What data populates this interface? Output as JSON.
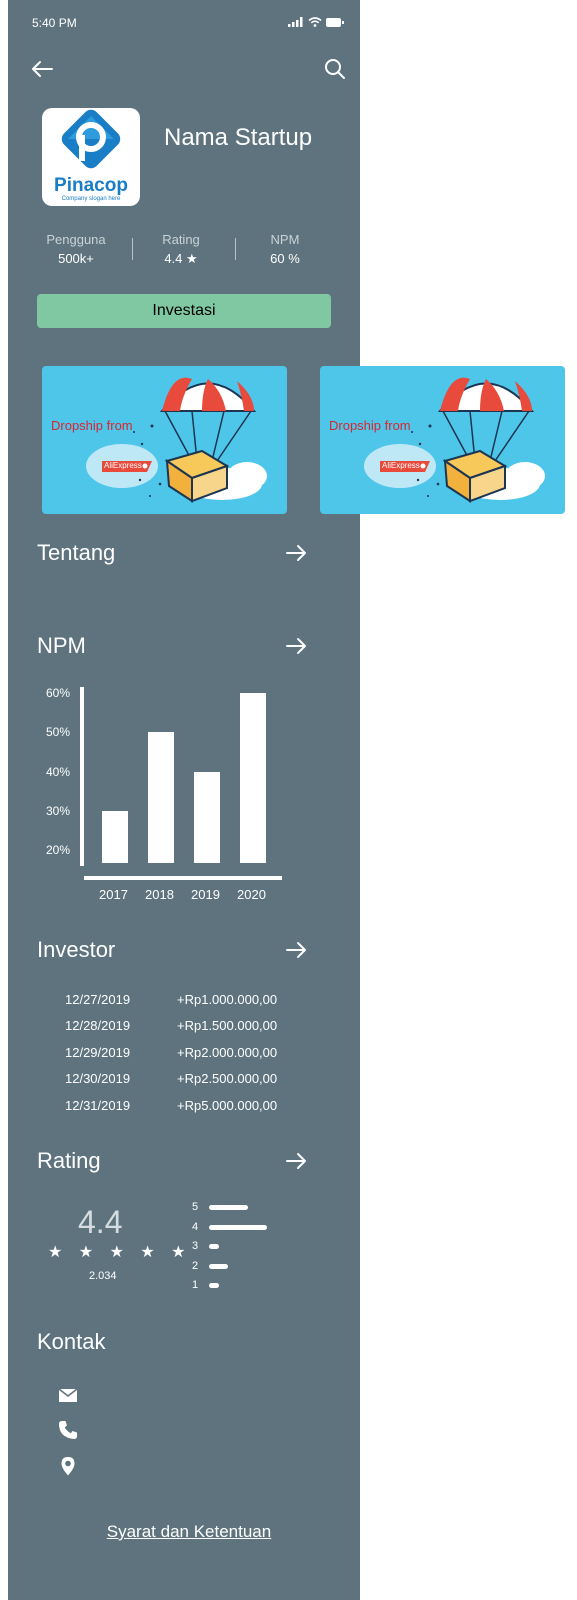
{
  "status": {
    "time": "5:40 PM"
  },
  "app": {
    "title": "Nama Startup",
    "logo_text": "Pinacop",
    "logo_slogan": "Company slogan here"
  },
  "stats": [
    {
      "label": "Pengguna",
      "value": "500k+"
    },
    {
      "label": "Rating",
      "value": "4.4 ★"
    },
    {
      "label": "NPM",
      "value": "60 %"
    }
  ],
  "invest_button": "Investasi",
  "banners": [
    {
      "text": "Dropship from",
      "tag": "AliExpress"
    },
    {
      "text": "Dropship from",
      "tag": "AliExpress"
    }
  ],
  "sections": {
    "about": "Tentang",
    "npm": "NPM",
    "investor": "Investor",
    "rating": "Rating",
    "contact": "Kontak"
  },
  "chart_data": {
    "type": "bar",
    "categories": [
      "2017",
      "2018",
      "2019",
      "2020"
    ],
    "values": [
      30,
      50,
      40,
      60
    ],
    "yticks": [
      "20%",
      "30%",
      "40%",
      "50%",
      "60%"
    ],
    "ylim": [
      20,
      60
    ],
    "title": "",
    "xlabel": "",
    "ylabel": ""
  },
  "investors": [
    {
      "date": "12/27/2019",
      "amount": "+Rp1.000.000,00"
    },
    {
      "date": "12/28/2019",
      "amount": "+Rp1.500.000,00"
    },
    {
      "date": "12/29/2019",
      "amount": "+Rp2.000.000,00"
    },
    {
      "date": "12/30/2019",
      "amount": "+Rp2.500.000,00"
    },
    {
      "date": "12/31/2019",
      "amount": "+Rp5.000.000,00"
    }
  ],
  "rating": {
    "score": "4.4",
    "stars": "★ ★ ★ ★ ★",
    "count": "2.034",
    "breakdown": [
      {
        "label": "5",
        "fraction": 0.67
      },
      {
        "label": "4",
        "fraction": 1.0
      },
      {
        "label": "3",
        "fraction": 0.17
      },
      {
        "label": "2",
        "fraction": 0.33
      },
      {
        "label": "1",
        "fraction": 0.17
      }
    ]
  },
  "contacts": [
    {
      "icon": "mail-icon"
    },
    {
      "icon": "phone-icon"
    },
    {
      "icon": "location-pin-icon"
    }
  ],
  "terms": "Syarat dan Ketentuan",
  "colors": {
    "background": "#5e737d",
    "accent_button": "#80c8a2",
    "banner": "#4dc6ea"
  }
}
